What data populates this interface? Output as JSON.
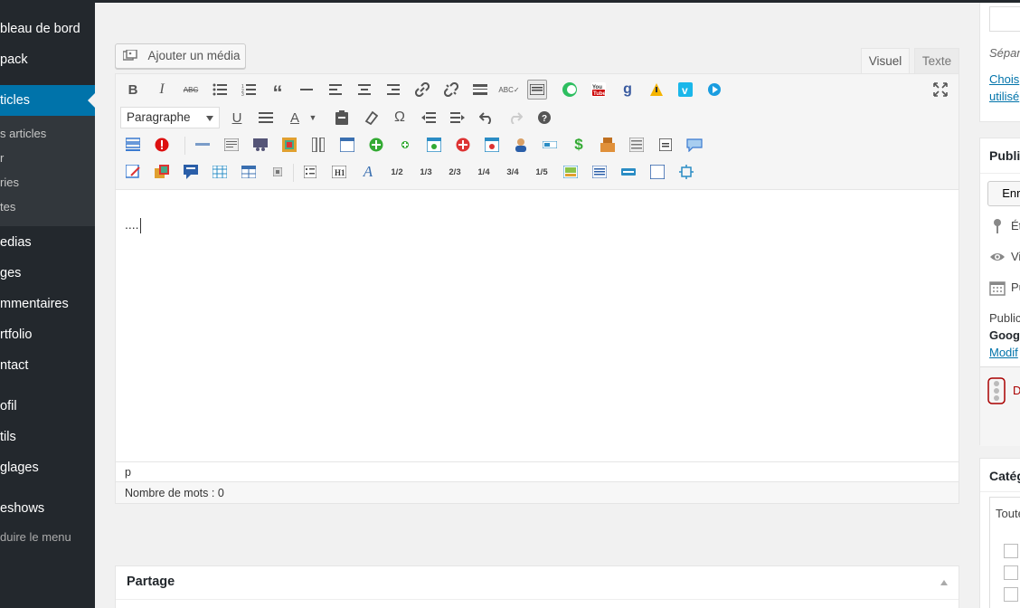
{
  "sidebar": {
    "items": [
      {
        "label": "bleau de bord"
      },
      {
        "label": "pack"
      },
      {
        "label": "ticles"
      },
      {
        "label": "edias"
      },
      {
        "label": "ges"
      },
      {
        "label": "mmentaires"
      },
      {
        "label": "rtfolio"
      },
      {
        "label": "ntact"
      },
      {
        "label": "ofil"
      },
      {
        "label": "tils"
      },
      {
        "label": "glages"
      },
      {
        "label": "eshows"
      }
    ],
    "submenu": [
      {
        "label": "s articles"
      },
      {
        "label": "r"
      },
      {
        "label": "ries"
      },
      {
        "label": "tes"
      }
    ],
    "collapse": "duire le menu"
  },
  "editor": {
    "add_media": "Ajouter un média",
    "tab_visual": "Visuel",
    "tab_text": "Texte",
    "format": "Paragraphe",
    "content": "....",
    "path": "p",
    "word_count": "Nombre de mots : 0",
    "shortcodes": [
      "1/2",
      "1/3",
      "2/3",
      "1/4",
      "3/4",
      "1/5"
    ]
  },
  "partage": {
    "title": "Partage"
  },
  "right": {
    "separator_hint": "Sépara",
    "choose_link": "Chois",
    "used_link": "utilisé",
    "publish_title": "Publi",
    "save_button": "Enre",
    "status": "Ét",
    "visibility": "Vi",
    "publish_date": "Pu",
    "publish_text": "Public",
    "google_text": "Googl",
    "modify_link": "Modif",
    "delete_text": "D",
    "categories_title": "Catég",
    "categories_tab": "Toute"
  },
  "colors": {
    "sidebar_bg": "#23282d",
    "active": "#0073aa",
    "link": "#0073aa",
    "danger": "#a00"
  }
}
